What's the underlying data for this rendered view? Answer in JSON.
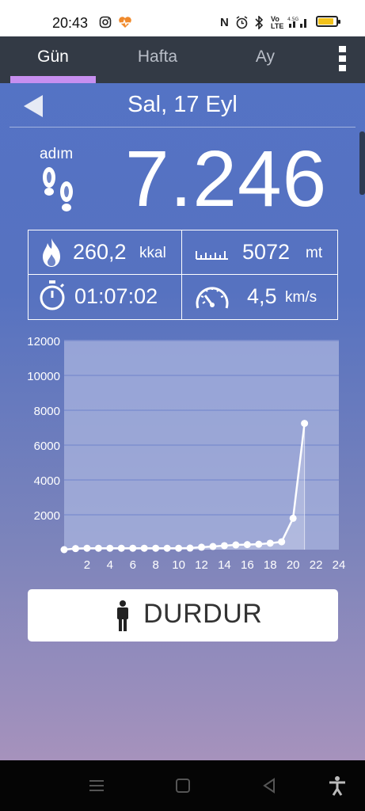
{
  "status_bar": {
    "time": "20:43",
    "icons": [
      "instagram-icon",
      "heart-app-icon",
      "nfc-icon",
      "alarm-icon",
      "bluetooth-icon",
      "volte-icon",
      "signal-icon",
      "battery-icon"
    ],
    "battery_level": 0.85
  },
  "tabs": [
    {
      "label": "Gün",
      "active": true
    },
    {
      "label": "Hafta",
      "active": false
    },
    {
      "label": "Ay",
      "active": false
    }
  ],
  "date_header": {
    "date": "Sal, 17 Eyl"
  },
  "steps": {
    "label": "adım",
    "value": "7.246"
  },
  "stats": {
    "calories": {
      "value": "260,2",
      "unit": "kkal"
    },
    "distance": {
      "value": "5072",
      "unit": "mt"
    },
    "duration": {
      "value": "01:07:02"
    },
    "speed": {
      "value": "4,5",
      "unit": "km/s"
    }
  },
  "chart_data": {
    "type": "line",
    "x": [
      0,
      1,
      2,
      3,
      4,
      5,
      6,
      7,
      8,
      9,
      10,
      11,
      12,
      13,
      14,
      15,
      16,
      17,
      18,
      19,
      20,
      21
    ],
    "y": [
      0,
      60,
      80,
      80,
      80,
      80,
      80,
      80,
      80,
      80,
      80,
      90,
      140,
      180,
      230,
      270,
      290,
      310,
      370,
      450,
      1800,
      7246
    ],
    "xticks": [
      "2",
      "4",
      "6",
      "8",
      "10",
      "12",
      "14",
      "16",
      "18",
      "20",
      "22",
      "24"
    ],
    "yticks": [
      "2000",
      "4000",
      "6000",
      "8000",
      "10000",
      "12000"
    ],
    "xlim": [
      0,
      24
    ],
    "ylim": [
      0,
      12000
    ],
    "grid": true
  },
  "stop_button": {
    "label": "DURDUR"
  },
  "colors": {
    "tabbar": "#333a45",
    "tab_indicator": "#c78ff0",
    "chart_plot_bg": "#a9b4df",
    "chart_line": "#ffffff"
  }
}
